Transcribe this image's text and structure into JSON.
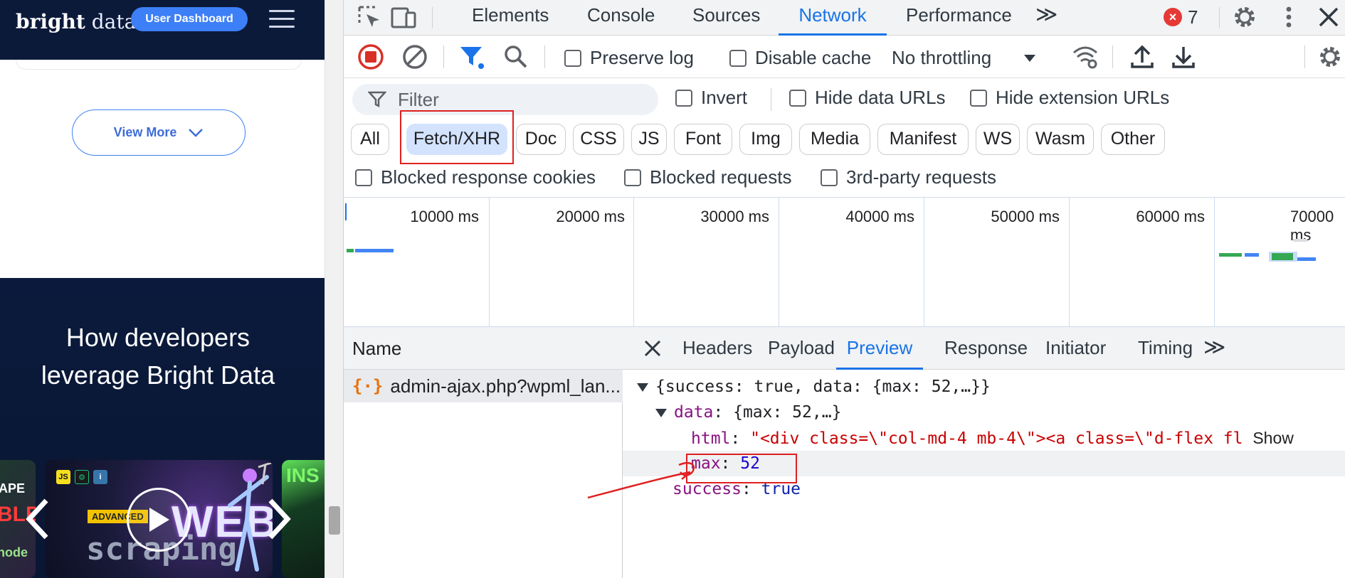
{
  "site": {
    "logo_bold": "bright",
    "logo_light": "data",
    "dashboard_button": "User Dashboard",
    "view_more": "View More",
    "heading_line1": "How developers",
    "heading_line2": "leverage Bright Data",
    "thumb_a": {
      "line1": "APE",
      "line2": "BLE",
      "line3": "node"
    },
    "thumb_b": {
      "advanced": "ADVANCED",
      "web": "WEB",
      "scraping": "scraping",
      "badges": [
        "JS",
        "⚙",
        "i"
      ]
    },
    "thumb_c": {
      "text": "INS"
    }
  },
  "devtools": {
    "panel_tabs": [
      "Elements",
      "Console",
      "Sources",
      "Network",
      "Performance"
    ],
    "active_panel": "Network",
    "more_tabs": "≫",
    "error_count": "7",
    "toolbar": {
      "preserve_log": "Preserve log",
      "disable_cache": "Disable cache",
      "throttling": "No throttling"
    },
    "filter": {
      "placeholder": "Filter",
      "invert": "Invert",
      "hide_data_urls": "Hide data URLs",
      "hide_extension_urls": "Hide extension URLs"
    },
    "type_filters": [
      "All",
      "Fetch/XHR",
      "Doc",
      "CSS",
      "JS",
      "Font",
      "Img",
      "Media",
      "Manifest",
      "WS",
      "Wasm",
      "Other"
    ],
    "active_type": "Fetch/XHR",
    "blocked": {
      "cookies": "Blocked response cookies",
      "requests": "Blocked requests",
      "third_party": "3rd-party requests"
    },
    "timeline_labels": [
      "10000 ms",
      "20000 ms",
      "30000 ms",
      "40000 ms",
      "50000 ms",
      "60000 ms",
      "70000 ms"
    ],
    "name_header": "Name",
    "request_name": "admin-ajax.php?wpml_lan...",
    "detail_tabs": [
      "Headers",
      "Payload",
      "Preview",
      "Response",
      "Initiator",
      "Timing"
    ],
    "active_detail_tab": "Preview",
    "preview": {
      "root_summary": "{success: true, data: {max: 52,…}}",
      "data_key": "data",
      "data_summary": "{max: 52,…}",
      "html_key": "html",
      "html_value": "\"<div class=\\\"col-md-4 mb-4\\\"><a class=\\\"d-flex fl",
      "show_more": "Show",
      "max_key": "max",
      "max_value": "52",
      "success_key": "success",
      "success_value": "true"
    }
  },
  "colors": {
    "site_header": "#0c1a3a",
    "accent_blue": "#1a73e8",
    "highlight_red": "#e02020",
    "active_pill": "#d3e3fd"
  }
}
